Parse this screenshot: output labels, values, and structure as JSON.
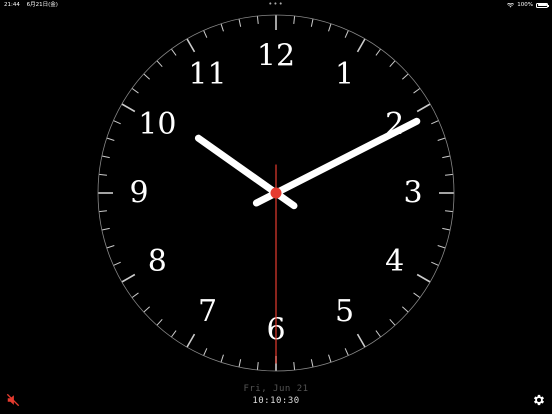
{
  "status_bar": {
    "time": "21:44",
    "date": "6月21日(金)",
    "dots": "•••",
    "battery_text": "100%",
    "battery_level": 1.0
  },
  "clock": {
    "numerals": [
      "12",
      "1",
      "2",
      "3",
      "4",
      "5",
      "6",
      "7",
      "8",
      "9",
      "10",
      "11"
    ],
    "hours": 10,
    "minutes": 10,
    "seconds": 30,
    "colors": {
      "face": "#000000",
      "hands": "#ffffff",
      "second_hand": "#e53b2f",
      "ticks": "#cccccc"
    }
  },
  "footer": {
    "date": "Fri, Jun 21",
    "time": "10:10:30"
  },
  "controls": {
    "mute_icon": "speaker-muted-icon",
    "mute_color": "#e53b2f",
    "settings_icon": "gear-icon"
  }
}
